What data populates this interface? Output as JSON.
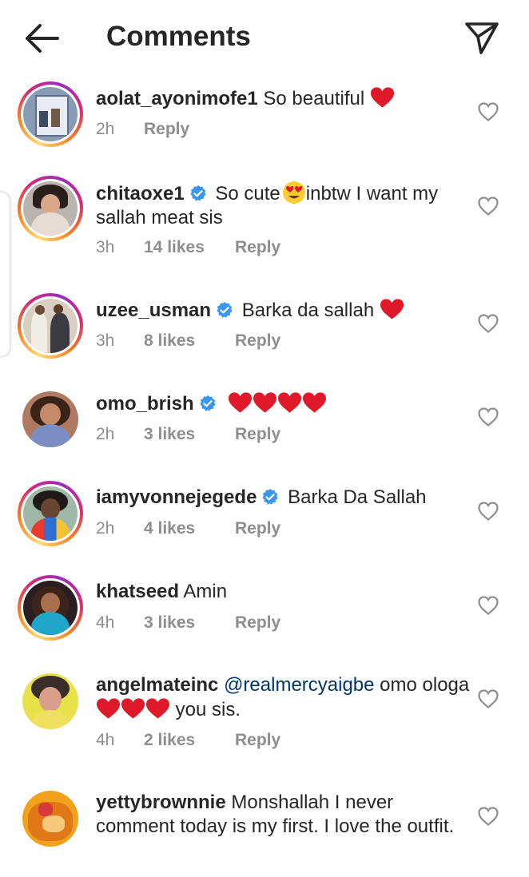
{
  "header": {
    "title": "Comments"
  },
  "reply_label": "Reply",
  "comments": [
    {
      "username": "aolat_ayonimofe1",
      "verified": false,
      "text": "So beautiful",
      "time": "2h",
      "likes": "",
      "hearts": 1
    },
    {
      "username": "chitaoxe1",
      "verified": true,
      "text": "So cute",
      "text2": "inbtw I want my sallah meat sis",
      "time": "3h",
      "likes": "14 likes",
      "emoji": "heart-eyes"
    },
    {
      "username": "uzee_usman",
      "verified": true,
      "text": "Barka da sallah",
      "time": "3h",
      "likes": "8 likes",
      "hearts": 1
    },
    {
      "username": "omo_brish",
      "verified": true,
      "text": "",
      "time": "2h",
      "likes": "3 likes",
      "hearts": 4
    },
    {
      "username": "iamyvonnejegede",
      "verified": true,
      "text": "Barka Da Sallah",
      "time": "2h",
      "likes": "4 likes"
    },
    {
      "username": "khatseed",
      "verified": false,
      "text": "Amin",
      "time": "4h",
      "likes": "3 likes"
    },
    {
      "username": "angelmateinc",
      "verified": false,
      "mention": "@realmercyaigbe",
      "text": "omo ologa",
      "text2": "you sis.",
      "time": "4h",
      "likes": "2 likes",
      "hearts": 3
    },
    {
      "username": "yettybrownnie",
      "verified": false,
      "text": "Monshallah I never comment today is my first. I love the outfit.",
      "time": "",
      "likes": ""
    }
  ],
  "colors": {
    "heart_red": "#e0192a",
    "verified_blue": "#3897f0",
    "meta_gray": "#8e8e8e",
    "mention_blue": "#00376b"
  }
}
